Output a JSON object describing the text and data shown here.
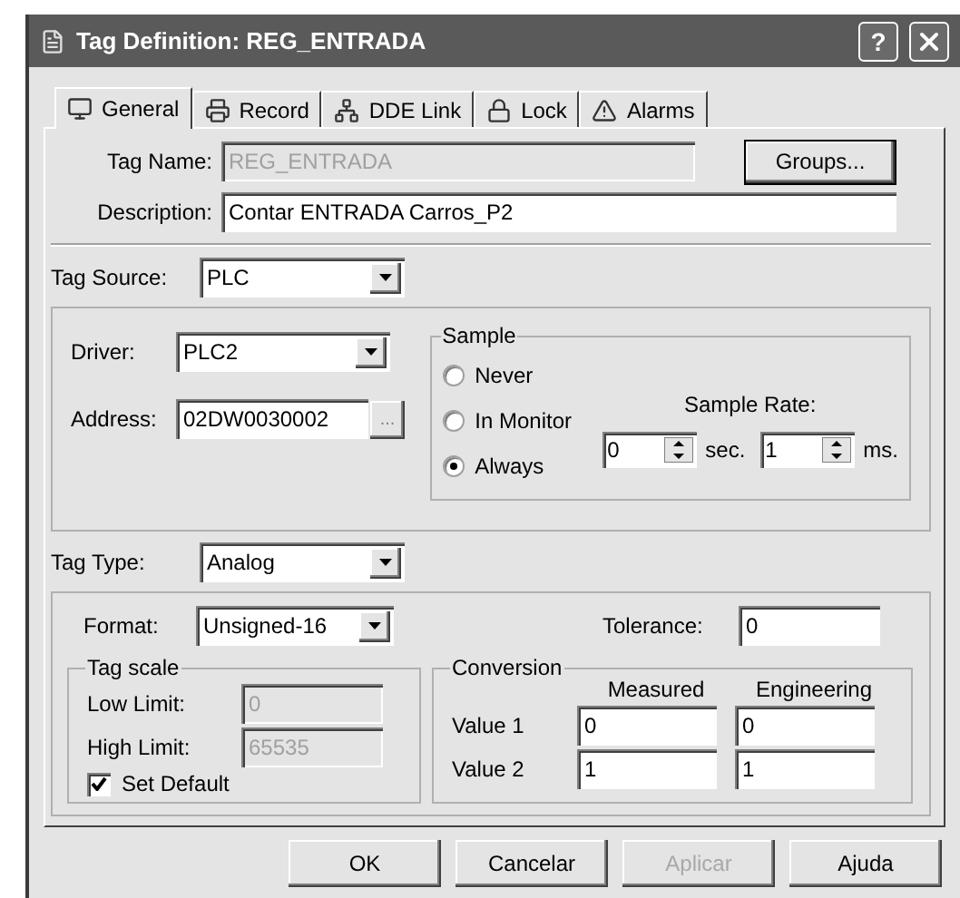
{
  "window": {
    "title": "Tag Definition: REG_ENTRADA",
    "help": "?"
  },
  "tabs": [
    {
      "label": "General",
      "selected": true
    },
    {
      "label": "Record",
      "selected": false
    },
    {
      "label": "DDE Link",
      "selected": false
    },
    {
      "label": "Lock",
      "selected": false
    },
    {
      "label": "Alarms",
      "selected": false
    }
  ],
  "tag_name": {
    "label": "Tag Name:",
    "value": "REG_ENTRADA",
    "disabled": true
  },
  "groups_button": "Groups...",
  "description": {
    "label": "Description:",
    "value": "Contar ENTRADA Carros_P2",
    "disabled": false
  },
  "tag_source": {
    "label": "Tag Source:",
    "value": "PLC"
  },
  "driver": {
    "label": "Driver:",
    "value": "PLC2"
  },
  "address": {
    "label": "Address:",
    "value": "02DW0030002",
    "browse": "..."
  },
  "sample": {
    "title": "Sample",
    "options": [
      {
        "label": "Never",
        "selected": false
      },
      {
        "label": "In Monitor",
        "selected": false
      },
      {
        "label": "Always",
        "selected": true
      }
    ],
    "rate_label": "Sample Rate:",
    "seconds": {
      "value": "0",
      "unit": "sec."
    },
    "milliseconds": {
      "value": "1",
      "unit": "ms."
    }
  },
  "tag_type": {
    "label": "Tag Type:",
    "value": "Analog"
  },
  "format": {
    "label": "Format:",
    "value": "Unsigned-16"
  },
  "tolerance": {
    "label": "Tolerance:",
    "value": "0"
  },
  "tag_scale": {
    "title": "Tag scale",
    "low_limit": {
      "label": "Low Limit:",
      "value": "0",
      "disabled": true
    },
    "high_limit": {
      "label": "High Limit:",
      "value": "65535",
      "disabled": true
    },
    "set_default": {
      "label": "Set Default",
      "checked": true
    }
  },
  "conversion": {
    "title": "Conversion",
    "columns": [
      "Measured",
      "Engineering"
    ],
    "rows": [
      {
        "label": "Value 1",
        "measured": "0",
        "engineering": "0"
      },
      {
        "label": "Value 2",
        "measured": "1",
        "engineering": "1"
      }
    ]
  },
  "buttons": [
    {
      "label": "OK",
      "disabled": false
    },
    {
      "label": "Cancelar",
      "disabled": false
    },
    {
      "label": "Aplicar",
      "disabled": true
    },
    {
      "label": "Ajuda",
      "disabled": false
    }
  ]
}
